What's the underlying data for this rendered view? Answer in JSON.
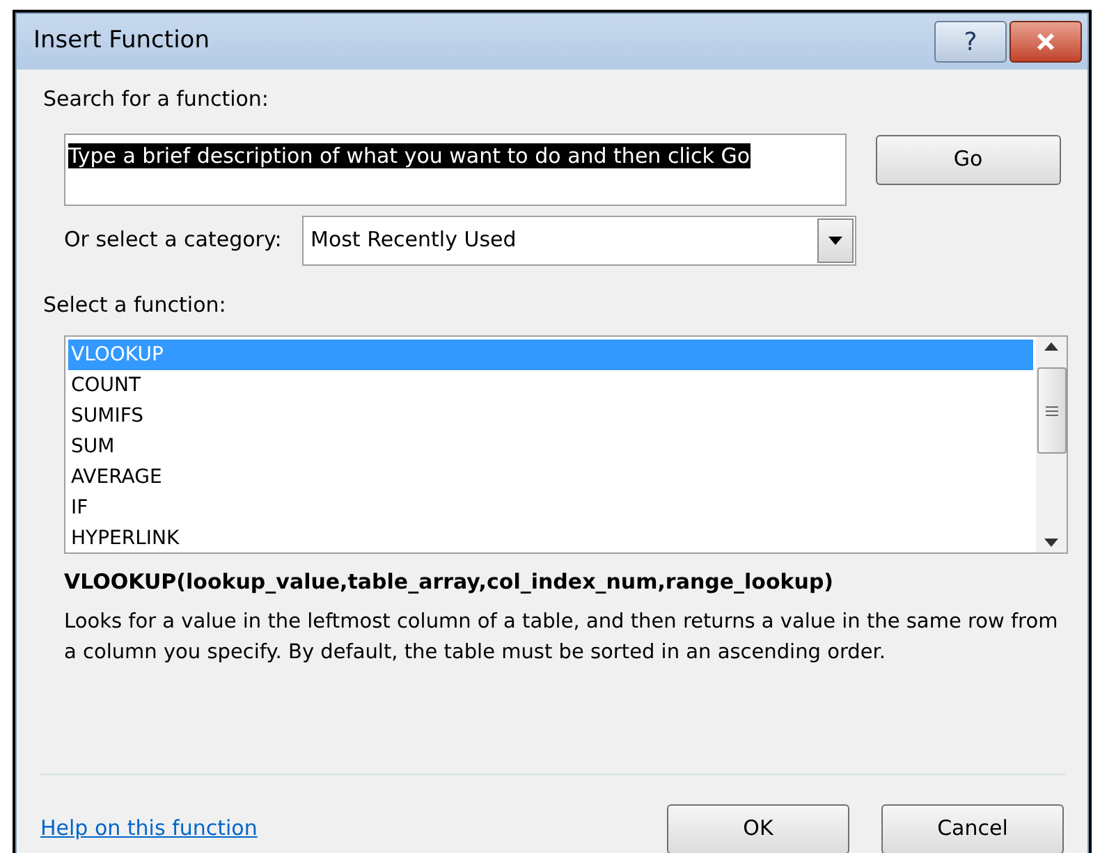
{
  "window": {
    "title": "Insert Function",
    "buttons": [
      {
        "kind": "help",
        "label": "?"
      },
      {
        "kind": "close"
      }
    ]
  },
  "search": {
    "label": "Search for a function:",
    "value": "Type a brief description of what you want to do and then click Go",
    "text_selected": true,
    "button": "Go"
  },
  "category": {
    "label": "Or select a category:",
    "value": "Most Recently Used"
  },
  "functions": {
    "label": "Select a function:",
    "items": [
      {
        "name": "VLOOKUP",
        "selected": true
      },
      {
        "name": "COUNT",
        "selected": false
      },
      {
        "name": "SUMIFS",
        "selected": false
      },
      {
        "name": "SUM",
        "selected": false
      },
      {
        "name": "AVERAGE",
        "selected": false
      },
      {
        "name": "IF",
        "selected": false
      },
      {
        "name": "HYPERLINK",
        "selected": false
      }
    ]
  },
  "signature": "VLOOKUP(lookup_value,table_array,col_index_num,range_lookup)",
  "description": "Looks for a value in the leftmost column of a table, and then returns a value in the same row from a column you specify. By default, the table must be sorted in an ascending order.",
  "footer": {
    "link": "Help on this function",
    "buttons": [
      "OK",
      "Cancel"
    ]
  }
}
